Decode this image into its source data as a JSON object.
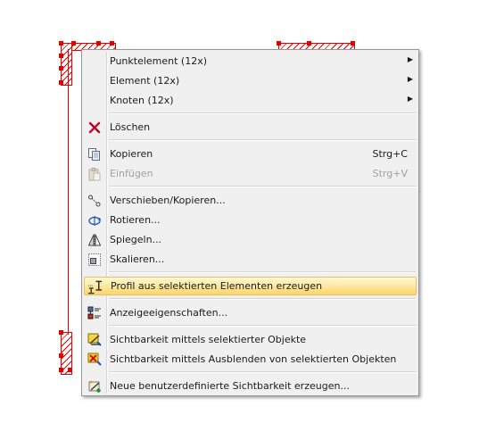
{
  "colors": {
    "accent_red": "#e00000",
    "menu_background": "#f0f0f0",
    "highlight": "#fde79a",
    "disabled_text": "#a0a0a0"
  },
  "menu": {
    "group_select": [
      {
        "label": "Punktelement (12x)",
        "submenu": true
      },
      {
        "label": "Element (12x)",
        "submenu": true
      },
      {
        "label": "Knoten (12x)",
        "submenu": true
      }
    ],
    "delete": {
      "label": "Löschen",
      "icon": "red-x-icon"
    },
    "copy": {
      "label": "Kopieren",
      "shortcut": "Strg+C",
      "icon": "copy-icon"
    },
    "paste": {
      "label": "Einfügen",
      "shortcut": "Strg+V",
      "icon": "paste-icon",
      "disabled": true
    },
    "move_copy": {
      "label": "Verschieben/Kopieren...",
      "icon": "move-icon"
    },
    "rotate": {
      "label": "Rotieren...",
      "icon": "rotate-icon"
    },
    "mirror": {
      "label": "Spiegeln...",
      "icon": "mirror-icon"
    },
    "scale": {
      "label": "Skalieren...",
      "icon": "scale-icon"
    },
    "create_profile": {
      "label": "Profil aus selektierten Elementen erzeugen",
      "icon": "profile-icon",
      "highlighted": true
    },
    "display_props": {
      "label": "Anzeigeeigenschaften...",
      "icon": "display-properties-icon"
    },
    "visibility_selected": {
      "label": "Sichtbarkeit mittels selektierter Objekte",
      "icon": "visibility-icon"
    },
    "visibility_hide": {
      "label": "Sichtbarkeit mittels Ausblenden von selektierten Objekten",
      "icon": "visibility-hide-icon"
    },
    "new_visibility": {
      "label": "Neue benutzerdefinierte Sichtbarkeit erzeugen...",
      "icon": "new-visibility-icon"
    }
  }
}
